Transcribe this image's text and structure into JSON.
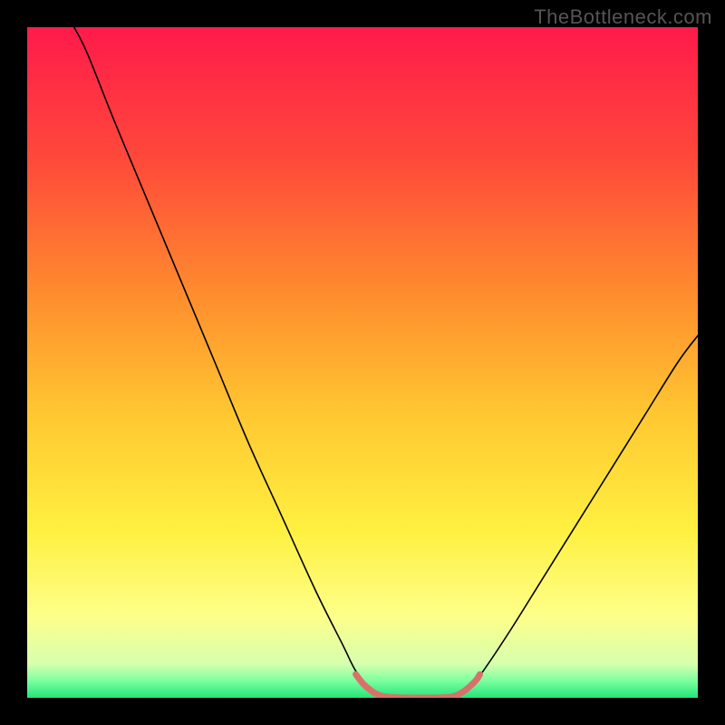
{
  "watermark": "TheBottleneck.com",
  "chart_data": {
    "type": "line",
    "title": "",
    "xlabel": "",
    "ylabel": "",
    "xlim": [
      0,
      100
    ],
    "ylim": [
      0,
      100
    ],
    "background_gradient": {
      "stops": [
        {
          "offset": 0.0,
          "color": "#ff1a4b"
        },
        {
          "offset": 0.2,
          "color": "#ff4a3a"
        },
        {
          "offset": 0.4,
          "color": "#ff8d2e"
        },
        {
          "offset": 0.58,
          "color": "#ffc831"
        },
        {
          "offset": 0.75,
          "color": "#fff040"
        },
        {
          "offset": 0.88,
          "color": "#fdff8a"
        },
        {
          "offset": 0.95,
          "color": "#d6ffae"
        },
        {
          "offset": 0.975,
          "color": "#7aff9e"
        },
        {
          "offset": 1.0,
          "color": "#23e57a"
        }
      ]
    },
    "series": [
      {
        "name": "bottleneck-curve",
        "color": "#000000",
        "width": 1.6,
        "points": [
          {
            "x": 7,
            "y": 100
          },
          {
            "x": 9,
            "y": 96
          },
          {
            "x": 13,
            "y": 86
          },
          {
            "x": 18,
            "y": 74
          },
          {
            "x": 23,
            "y": 62
          },
          {
            "x": 28,
            "y": 50
          },
          {
            "x": 33,
            "y": 38
          },
          {
            "x": 38,
            "y": 27
          },
          {
            "x": 43,
            "y": 16
          },
          {
            "x": 47,
            "y": 8
          },
          {
            "x": 49,
            "y": 4
          },
          {
            "x": 51,
            "y": 1.5
          },
          {
            "x": 53,
            "y": 0.3
          },
          {
            "x": 56,
            "y": 0.0
          },
          {
            "x": 59,
            "y": 0.0
          },
          {
            "x": 62,
            "y": 0.0
          },
          {
            "x": 64,
            "y": 0.3
          },
          {
            "x": 66,
            "y": 1.5
          },
          {
            "x": 68,
            "y": 4
          },
          {
            "x": 72,
            "y": 10
          },
          {
            "x": 77,
            "y": 18
          },
          {
            "x": 82,
            "y": 26
          },
          {
            "x": 87,
            "y": 34
          },
          {
            "x": 92,
            "y": 42
          },
          {
            "x": 97,
            "y": 50
          },
          {
            "x": 100,
            "y": 54
          }
        ]
      },
      {
        "name": "optimal-region-marker",
        "color": "#d9716b",
        "width": 7,
        "points": [
          {
            "x": 49,
            "y": 3.5
          },
          {
            "x": 50,
            "y": 2.2
          },
          {
            "x": 51,
            "y": 1.3
          },
          {
            "x": 52,
            "y": 0.6
          },
          {
            "x": 53,
            "y": 0.25
          },
          {
            "x": 55,
            "y": 0.05
          },
          {
            "x": 57,
            "y": 0.0
          },
          {
            "x": 59,
            "y": 0.0
          },
          {
            "x": 61,
            "y": 0.0
          },
          {
            "x": 63,
            "y": 0.1
          },
          {
            "x": 64,
            "y": 0.35
          },
          {
            "x": 65,
            "y": 0.9
          },
          {
            "x": 66,
            "y": 1.7
          },
          {
            "x": 67,
            "y": 2.7
          },
          {
            "x": 67.5,
            "y": 3.5
          }
        ]
      }
    ]
  }
}
